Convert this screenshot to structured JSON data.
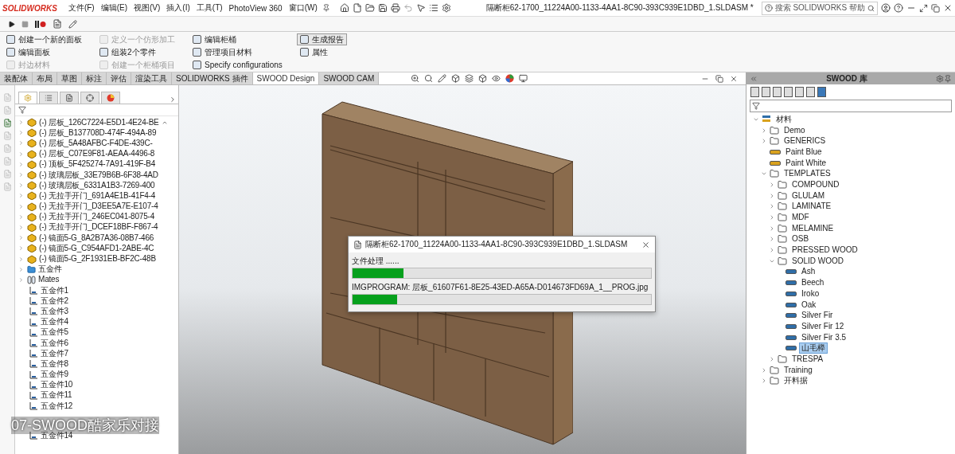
{
  "app": {
    "logo": "SOLIDWORKS",
    "menu": [
      "文件(F)",
      "编辑(E)",
      "视图(V)",
      "插入(I)",
      "工具(T)",
      "PhotoView 360",
      "窗口(W)"
    ],
    "title": "隔断柜62-1700_11224A00-1133-4AA1-8C90-393C939E1DBD_1.SLDASM *",
    "search": {
      "placeholder": "搜索 SOLIDWORKS 帮助"
    }
  },
  "command_manager": {
    "columns": [
      [
        {
          "label": "创建一个新的面板",
          "disabled": false,
          "selected": false
        },
        {
          "label": "编辑面板",
          "disabled": false,
          "selected": false
        },
        {
          "label": "封边材料",
          "disabled": true,
          "selected": false
        }
      ],
      [
        {
          "label": "定义一个仿形加工",
          "disabled": true,
          "selected": false
        },
        {
          "label": "组装2个零件",
          "disabled": false,
          "selected": false
        },
        {
          "label": "创建一个柜桶项目",
          "disabled": true,
          "selected": false
        }
      ],
      [
        {
          "label": "编辑柜桶",
          "disabled": false,
          "selected": false
        },
        {
          "label": "管理项目材料",
          "disabled": false,
          "selected": false
        },
        {
          "label": "Specify configurations",
          "disabled": false,
          "selected": false
        }
      ],
      [
        {
          "label": "生成报告",
          "disabled": false,
          "selected": true
        },
        {
          "label": "属性",
          "disabled": false,
          "selected": false
        }
      ]
    ]
  },
  "tabs": [
    {
      "label": "装配体",
      "selected": false
    },
    {
      "label": "布局",
      "selected": false
    },
    {
      "label": "草图",
      "selected": false
    },
    {
      "label": "标注",
      "selected": false
    },
    {
      "label": "评估",
      "selected": false
    },
    {
      "label": "渲染工具",
      "selected": false
    },
    {
      "label": "SOLIDWORKS 插件",
      "selected": false
    },
    {
      "label": "SWOOD Design",
      "selected": true
    },
    {
      "label": "SWOOD CAM",
      "selected": false
    }
  ],
  "feature_tree": {
    "panel_tabs": [
      {
        "selected": true
      },
      {
        "selected": false
      },
      {
        "selected": false
      },
      {
        "selected": false
      },
      {
        "selected": false
      }
    ],
    "items": [
      {
        "kind": "part",
        "label": "(-) 层板_126C7224-E5D1-4E24-BE"
      },
      {
        "kind": "part",
        "label": "(-) 层板_B137708D-474F-494A-89"
      },
      {
        "kind": "part",
        "label": "(-) 层板_5A48AFBC-F4DE-439C-"
      },
      {
        "kind": "part",
        "label": "(-) 层板_C07E9F81-AEAA-4496-8"
      },
      {
        "kind": "part",
        "label": "(-) 顶板_5F425274-7A91-419F-B4"
      },
      {
        "kind": "part",
        "label": "(-) 玻璃层板_33E79B6B-6F38-4AD"
      },
      {
        "kind": "part",
        "label": "(-) 玻璃层板_6331A1B3-7269-400"
      },
      {
        "kind": "part",
        "label": "(-) 无拉手开门_691A4E1B-41F4-4"
      },
      {
        "kind": "part",
        "label": "(-) 无拉手开门_D3EE5A7E-E107-4"
      },
      {
        "kind": "part",
        "label": "(-) 无拉手开门_246EC041-8075-4"
      },
      {
        "kind": "part",
        "label": "(-) 无拉手开门_DCEF18BF-F867-4"
      },
      {
        "kind": "part",
        "label": "(-) 镜面5-G_8A2B7A36-08B7-466"
      },
      {
        "kind": "part",
        "label": "(-) 镜面5-G_C954AFD1-2ABE-4C"
      },
      {
        "kind": "part",
        "label": "(-) 镜面5-G_2F1931EB-BF2C-48B"
      },
      {
        "kind": "folder",
        "label": "五金件"
      },
      {
        "kind": "mates",
        "label": "Mates"
      },
      {
        "kind": "fastener",
        "label": "五金件1"
      },
      {
        "kind": "fastener",
        "label": "五金件2"
      },
      {
        "kind": "fastener",
        "label": "五金件3"
      },
      {
        "kind": "fastener",
        "label": "五金件4"
      },
      {
        "kind": "fastener",
        "label": "五金件5"
      },
      {
        "kind": "fastener",
        "label": "五金件6"
      },
      {
        "kind": "fastener",
        "label": "五金件7"
      },
      {
        "kind": "fastener",
        "label": "五金件8"
      },
      {
        "kind": "fastener",
        "label": "五金件9"
      },
      {
        "kind": "fastener",
        "label": "五金件10"
      },
      {
        "kind": "fastener",
        "label": "五金件11"
      },
      {
        "kind": "fastener",
        "label": "五金件12"
      },
      {
        "kind": "fastener",
        "label": "五金件14"
      }
    ]
  },
  "dialog": {
    "title": "隔断柜62-1700_11224A00-1133-4AA1-8C90-393C939E1DBD_1.SLDASM",
    "tasks": [
      {
        "label": "文件处理 ......",
        "level": 0.17
      },
      {
        "label": "IMGPROGRAM: 层板_61607F61-8E25-43ED-A65A-D014673FD69A_1__PROG.jpg",
        "level": 0.15
      }
    ]
  },
  "library": {
    "title": "SWOOD 库",
    "tree": [
      {
        "kind": "root",
        "label": "材料",
        "expanded": true,
        "children": [
          {
            "kind": "folder",
            "label": "Demo",
            "expanded": false
          },
          {
            "kind": "folder",
            "label": "GENERICS",
            "expanded": false
          },
          {
            "kind": "material",
            "label": "Paint Blue",
            "color": "#d9a21e",
            "selected": false
          },
          {
            "kind": "material",
            "label": "Paint White",
            "color": "#d9a21e",
            "selected": false
          },
          {
            "kind": "folder",
            "label": "TEMPLATES",
            "expanded": true,
            "children": [
              {
                "kind": "folder",
                "label": "COMPOUND",
                "expanded": false
              },
              {
                "kind": "folder",
                "label": "GLULAM",
                "expanded": false
              },
              {
                "kind": "folder",
                "label": "LAMINATE",
                "expanded": false
              },
              {
                "kind": "folder",
                "label": "MDF",
                "expanded": false
              },
              {
                "kind": "folder",
                "label": "MELAMINE",
                "expanded": false
              },
              {
                "kind": "folder",
                "label": "OSB",
                "expanded": false
              },
              {
                "kind": "folder",
                "label": "PRESSED WOOD",
                "expanded": false
              },
              {
                "kind": "folder",
                "label": "SOLID WOOD",
                "expanded": true,
                "children": [
                  {
                    "kind": "material",
                    "label": "Ash",
                    "color": "#2f6ea8",
                    "selected": false
                  },
                  {
                    "kind": "material",
                    "label": "Beech",
                    "color": "#2f6ea8",
                    "selected": false
                  },
                  {
                    "kind": "material",
                    "label": "Iroko",
                    "color": "#2f6ea8",
                    "selected": false
                  },
                  {
                    "kind": "material",
                    "label": "Oak",
                    "color": "#2f6ea8",
                    "selected": false
                  },
                  {
                    "kind": "material",
                    "label": "Silver Fir",
                    "color": "#2f6ea8",
                    "selected": false
                  },
                  {
                    "kind": "material",
                    "label": "Silver Fir 12",
                    "color": "#2f6ea8",
                    "selected": false
                  },
                  {
                    "kind": "material",
                    "label": "Silver Fir 3.5",
                    "color": "#2f6ea8",
                    "selected": false
                  },
                  {
                    "kind": "material",
                    "label": "山毛榉",
                    "color": "#2f6ea8",
                    "selected": true
                  }
                ]
              },
              {
                "kind": "folder",
                "label": "TRESPA",
                "expanded": false
              }
            ]
          },
          {
            "kind": "folder",
            "label": "Training",
            "expanded": false
          },
          {
            "kind": "folder",
            "label": "开料据",
            "expanded": false
          }
        ]
      }
    ]
  },
  "caption": "07-SWOOD酷家乐对接"
}
